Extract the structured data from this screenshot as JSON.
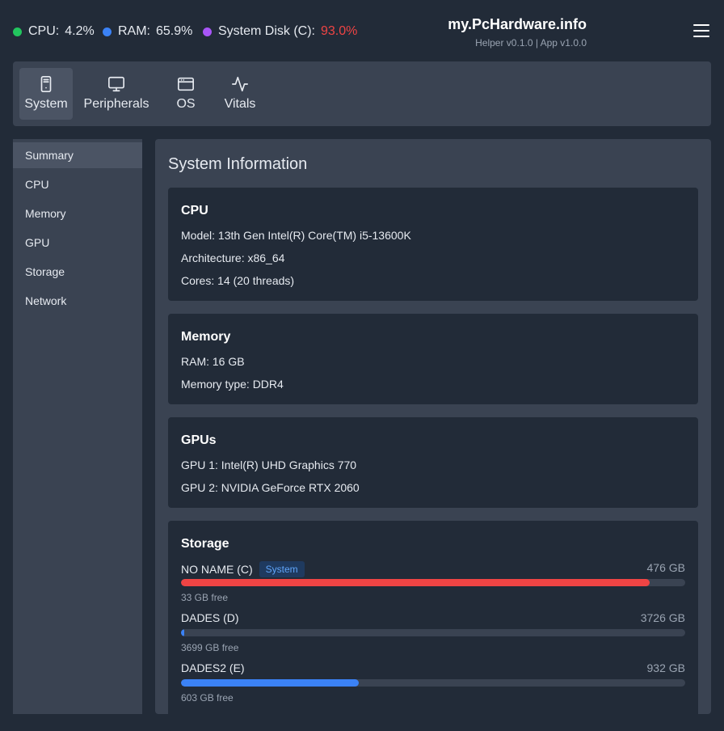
{
  "status": {
    "cpu": {
      "label": "CPU:",
      "value": "4.2%",
      "color": "#22c55e"
    },
    "ram": {
      "label": "RAM:",
      "value": "65.9%",
      "color": "#3b82f6"
    },
    "disk": {
      "label": "System Disk (C):",
      "value": "93.0%",
      "color": "#a855f7",
      "value_color": "#ef4444"
    }
  },
  "brand": {
    "name": "my.PcHardware.info",
    "version": "Helper v0.1.0 | App v1.0.0"
  },
  "menu_icon": "hamburger-icon",
  "tabs": [
    {
      "label": "System",
      "icon": "tower-icon",
      "active": true
    },
    {
      "label": "Peripherals",
      "icon": "monitor-icon",
      "active": false
    },
    {
      "label": "OS",
      "icon": "window-icon",
      "active": false
    },
    {
      "label": "Vitals",
      "icon": "activity-icon",
      "active": false
    }
  ],
  "sidebar": {
    "items": [
      {
        "label": "Summary",
        "active": true
      },
      {
        "label": "CPU"
      },
      {
        "label": "Memory"
      },
      {
        "label": "GPU"
      },
      {
        "label": "Storage"
      },
      {
        "label": "Network"
      }
    ]
  },
  "main": {
    "title": "System Information",
    "cpu": {
      "heading": "CPU",
      "model": "Model: 13th Gen Intel(R) Core(TM) i5-13600K",
      "architecture": "Architecture: x86_64",
      "cores": "Cores: 14 (20 threads)"
    },
    "memory": {
      "heading": "Memory",
      "ram": "RAM: 16 GB",
      "type": "Memory type: DDR4"
    },
    "gpus": {
      "heading": "GPUs",
      "gpu1": "GPU 1: Intel(R) UHD Graphics 770",
      "gpu2": "GPU 2: NVIDIA GeForce RTX 2060"
    },
    "storage": {
      "heading": "Storage",
      "drives": [
        {
          "name": "NO NAME (C)",
          "badge": "System",
          "size": "476 GB",
          "free": "33 GB free",
          "used_fraction": 0.93,
          "color": "#ef4444"
        },
        {
          "name": "DADES (D)",
          "size": "3726 GB",
          "free": "3699 GB free",
          "used_fraction": 0.007,
          "color": "#3b82f6"
        },
        {
          "name": "DADES2 (E)",
          "size": "932 GB",
          "free": "603 GB free",
          "used_fraction": 0.353,
          "color": "#3b82f6"
        }
      ]
    }
  }
}
